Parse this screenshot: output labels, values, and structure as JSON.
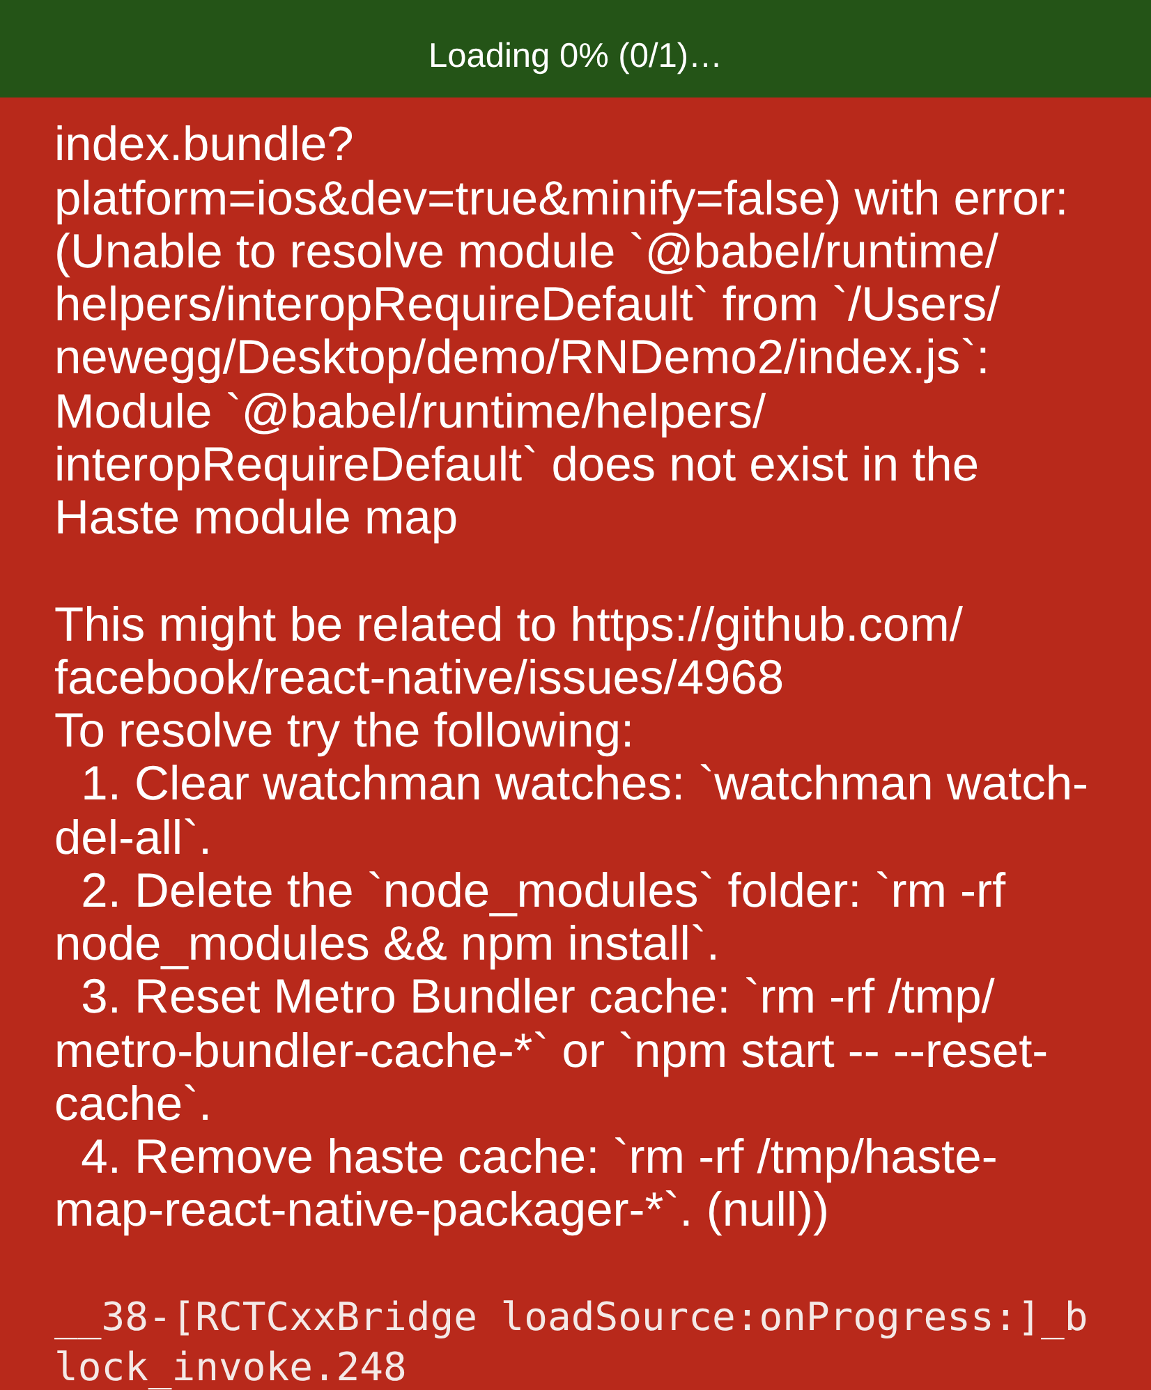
{
  "loading_banner": {
    "text": "Loading 0% (0/1)…"
  },
  "error_message": {
    "lines": [
      "index.bundle?",
      "platform=ios&dev=true&minify=false) with error:",
      "(Unable to resolve module `@babel/runtime/",
      "helpers/interopRequireDefault` from `/Users/",
      "newegg/Desktop/demo/RNDemo2/index.js`:",
      "Module `@babel/runtime/helpers/",
      "interopRequireDefault` does not exist in the",
      "Haste module map"
    ]
  },
  "hint": {
    "lines": [
      "This might be related to https://github.com/",
      "facebook/react-native/issues/4968"
    ]
  },
  "resolve_heading": "To resolve try the following:",
  "steps": [
    {
      "lines": [
        "  1. Clear watchman watches: `watchman watch-",
        "del-all`."
      ]
    },
    {
      "lines": [
        "  2. Delete the `node_modules` folder: `rm -rf",
        "node_modules && npm install`."
      ]
    },
    {
      "lines": [
        "  3. Reset Metro Bundler cache: `rm -rf /tmp/",
        "metro-bundler-cache-*` or `npm start -- --reset-",
        "cache`."
      ]
    },
    {
      "lines": [
        "  4. Remove haste cache: `rm -rf /tmp/haste-",
        "map-react-native-packager-*`. (null))"
      ]
    }
  ],
  "stack_frame": {
    "lines": [
      "__38-[RCTCxxBridge loadSource:onProgress:]_b",
      "lock_invoke.248"
    ]
  }
}
